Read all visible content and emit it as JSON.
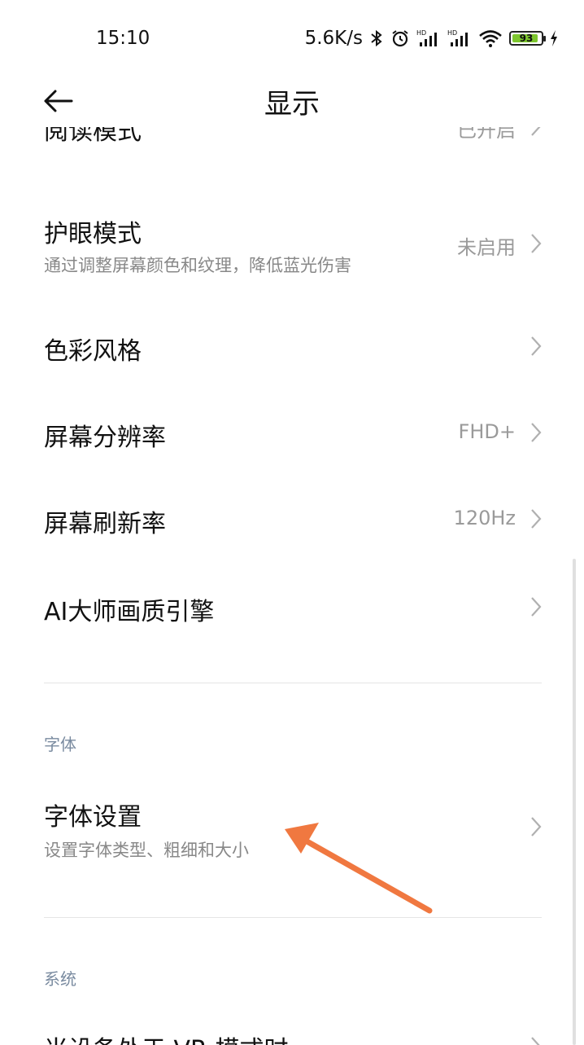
{
  "status": {
    "time": "15:10",
    "net_speed": "5.6K/s",
    "battery": "93",
    "icons": [
      "bluetooth-icon",
      "alarm-icon",
      "signal-hd-icon",
      "signal-hd-icon",
      "wifi-icon",
      "battery-icon",
      "charging-icon"
    ]
  },
  "header": {
    "title": "显示",
    "back_icon": "arrow-left-icon"
  },
  "rows": {
    "top_partial": {
      "title": "阅读模式",
      "value": "已开启"
    },
    "eye_care": {
      "title": "护眼模式",
      "subtitle": "通过调整屏幕颜色和纹理，降低蓝光伤害",
      "value": "未启用"
    },
    "color_style": {
      "title": "色彩风格"
    },
    "resolution": {
      "title": "屏幕分辨率",
      "value": "FHD+"
    },
    "refresh_rate": {
      "title": "屏幕刷新率",
      "value": "120Hz"
    },
    "ai_engine": {
      "title": "AI大师画质引擎"
    },
    "font_settings": {
      "title": "字体设置",
      "subtitle": "设置字体类型、粗细和大小"
    },
    "bottom_partial": {
      "title": "当设备处于 VR 模式时"
    }
  },
  "sections": {
    "font": "字体",
    "system": "系统"
  },
  "colors": {
    "annotation_arrow": "#f07840",
    "battery_fill": "#7dc62e"
  }
}
